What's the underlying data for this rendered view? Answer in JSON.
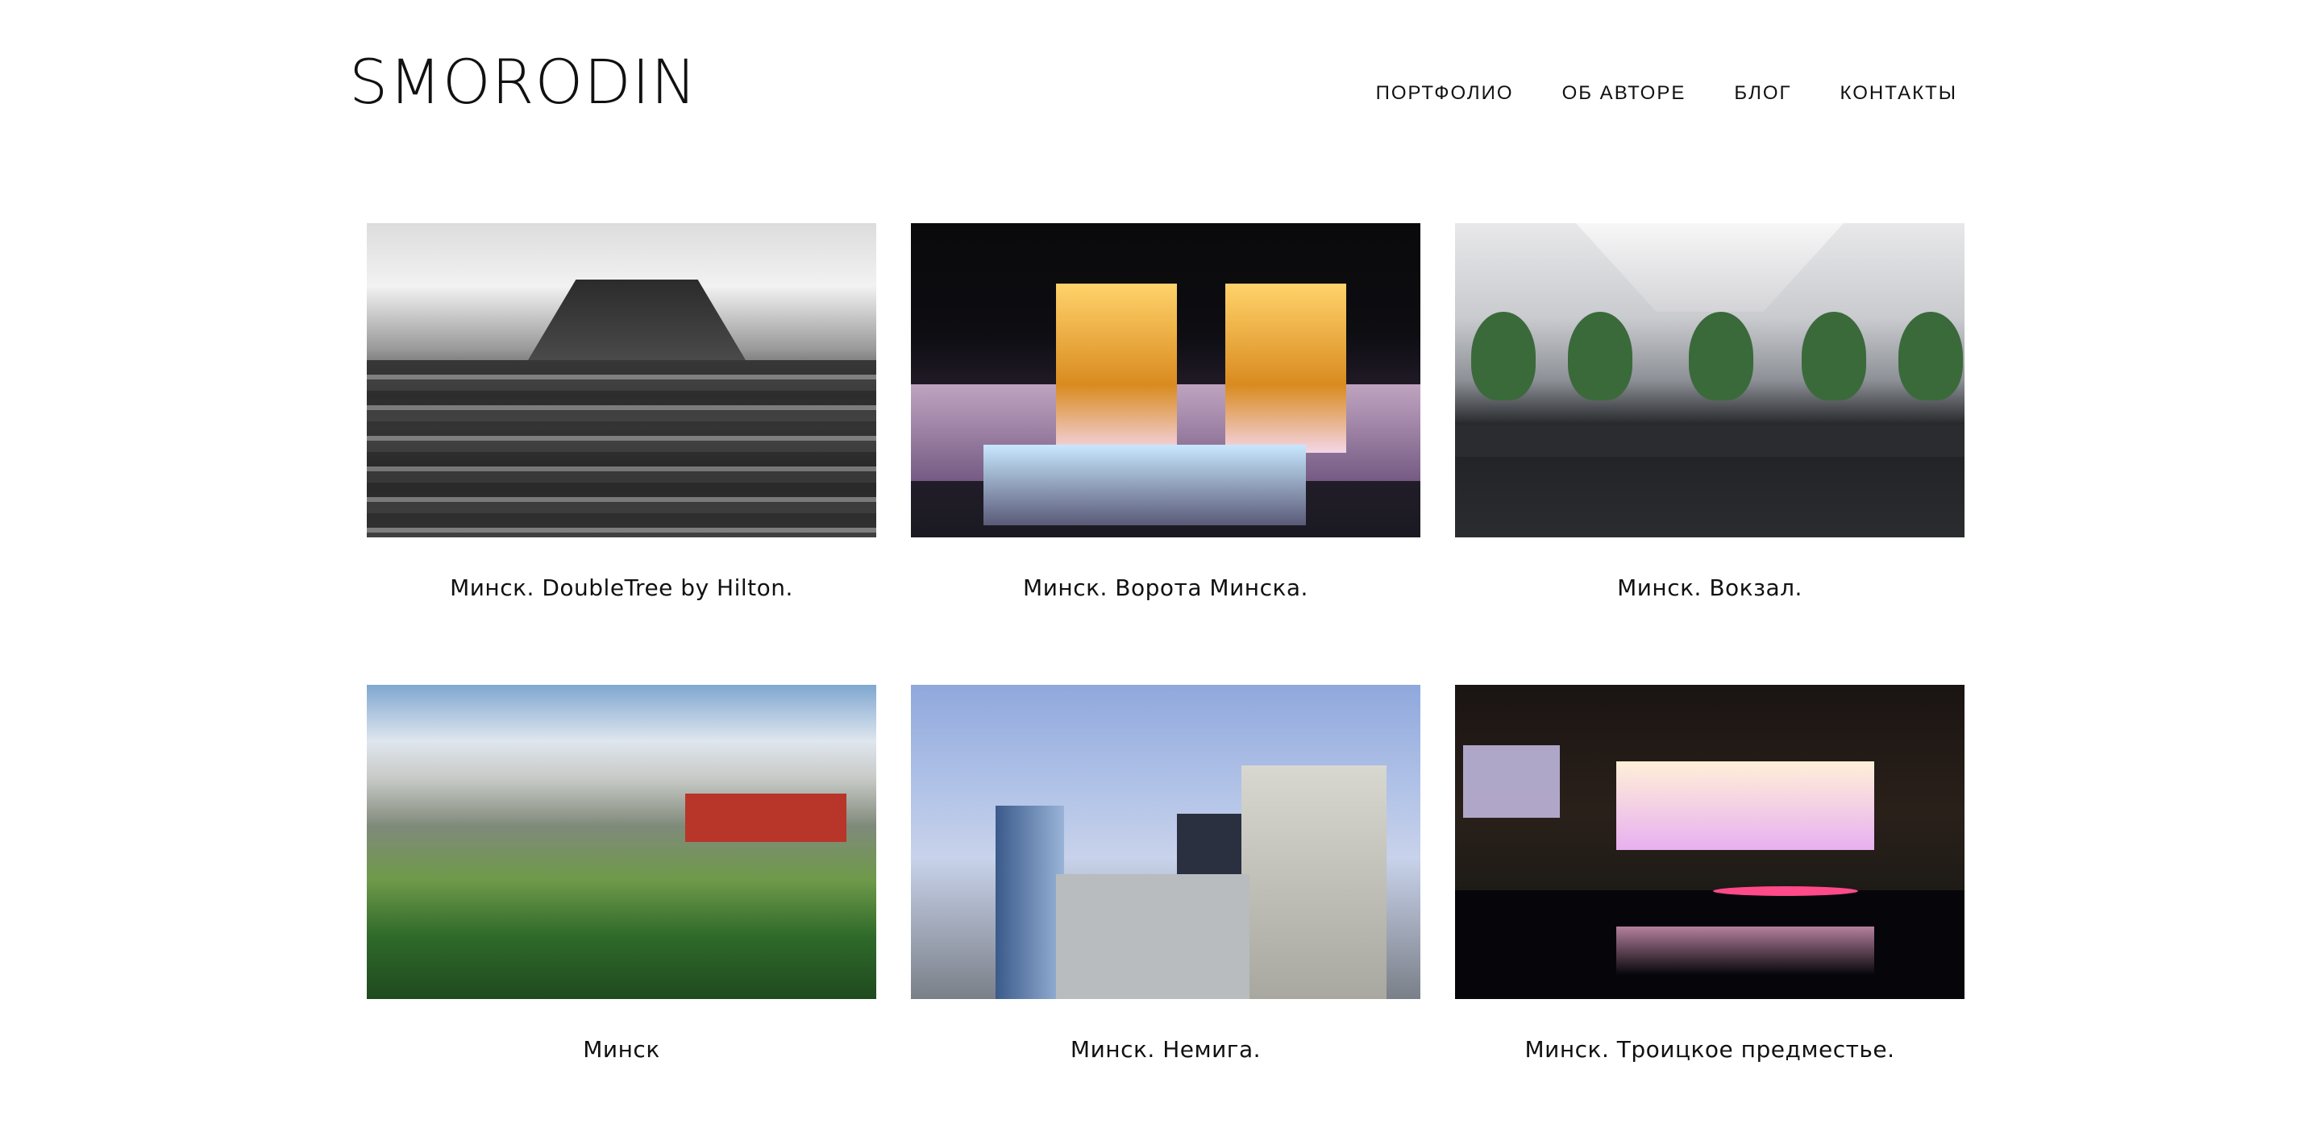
{
  "header": {
    "logo": "SMORODIN",
    "nav": [
      "ПОРТФОЛИО",
      "ОБ АВТОРЕ",
      "БЛОГ",
      "КОНТАКТЫ"
    ]
  },
  "gallery": [
    {
      "caption": "Минск. DoubleTree by Hilton."
    },
    {
      "caption": "Минск. Ворота Минска."
    },
    {
      "caption": "Минск. Вокзал."
    },
    {
      "caption": "Минск"
    },
    {
      "caption": "Минск. Немига."
    },
    {
      "caption": "Минск. Троицкое предместье."
    }
  ]
}
